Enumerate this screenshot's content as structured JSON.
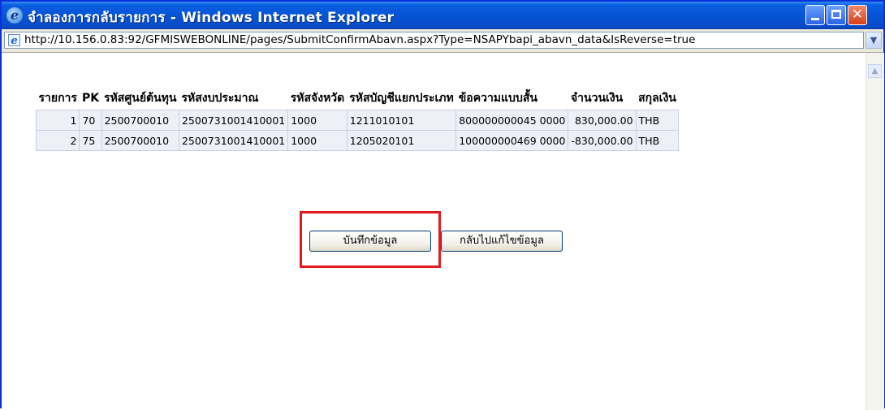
{
  "window": {
    "title": "จำลองการกลับรายการ - Windows Internet Explorer",
    "url": "http://10.156.0.83:92/GFMISWEBONLINE/pages/SubmitConfirmAbavn.aspx?Type=NSAPYbapi_abavn_data&IsReverse=true"
  },
  "table": {
    "headers": [
      "รายการ",
      "PK",
      "รหัสศูนย์ต้นทุน",
      "รหัสงบประมาณ",
      "รหัสจังหวัด",
      "รหัสบัญชีแยกประเภท",
      "ข้อความแบบสั้น",
      "จำนวนเงิน",
      "สกุลเงิน"
    ],
    "rows": [
      [
        "1",
        "70",
        "2500700010",
        "2500731001410001",
        "1000",
        "1211010101",
        "800000000045 0000",
        "830,000.00",
        "THB"
      ],
      [
        "2",
        "75",
        "2500700010",
        "2500731001410001",
        "1000",
        "1205020101",
        "100000000469 0000",
        "-830,000.00",
        "THB"
      ]
    ]
  },
  "buttons": {
    "save_label": "บันทึกข้อมูล",
    "back_label": "กลับไปแก้ไขข้อมูล"
  },
  "icons": {
    "browser": "ie-logo-icon",
    "page": "page-icon",
    "minimize": "minimize-icon",
    "maximize": "maximize-icon",
    "close": "close-icon",
    "dropdown": "chevron-down-icon",
    "scroll_up": "scroll-up-icon"
  },
  "colors": {
    "titlebar": "#0554d6",
    "highlight_box": "#e01b22",
    "row_bg": "#eef0f8"
  }
}
